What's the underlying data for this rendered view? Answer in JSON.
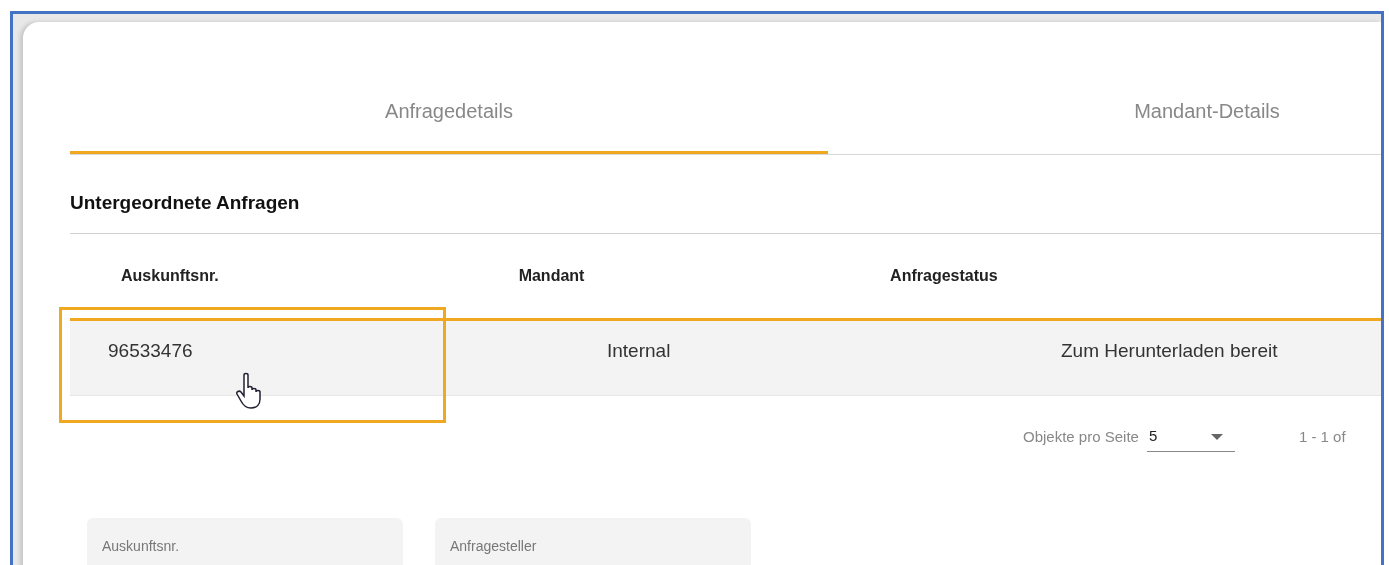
{
  "tabs": [
    {
      "label": "Anfragedetails",
      "selected": true
    },
    {
      "label": "Mandant-Details",
      "selected": false
    }
  ],
  "section_title": "Untergeordnete Anfragen",
  "table": {
    "columns": [
      "Auskunftsnr.",
      "Mandant",
      "Anfragestatus"
    ],
    "rows": [
      {
        "cells": [
          "96533476",
          "Internal",
          "Zum Herunterladen bereit"
        ],
        "selected": true
      }
    ]
  },
  "paginator": {
    "label": "Objekte pro Seite",
    "page_size": "5",
    "range": "1 - 1 of"
  },
  "detail_fields": [
    {
      "label": "Auskunftsnr."
    },
    {
      "label": "Anfragesteller"
    }
  ]
}
